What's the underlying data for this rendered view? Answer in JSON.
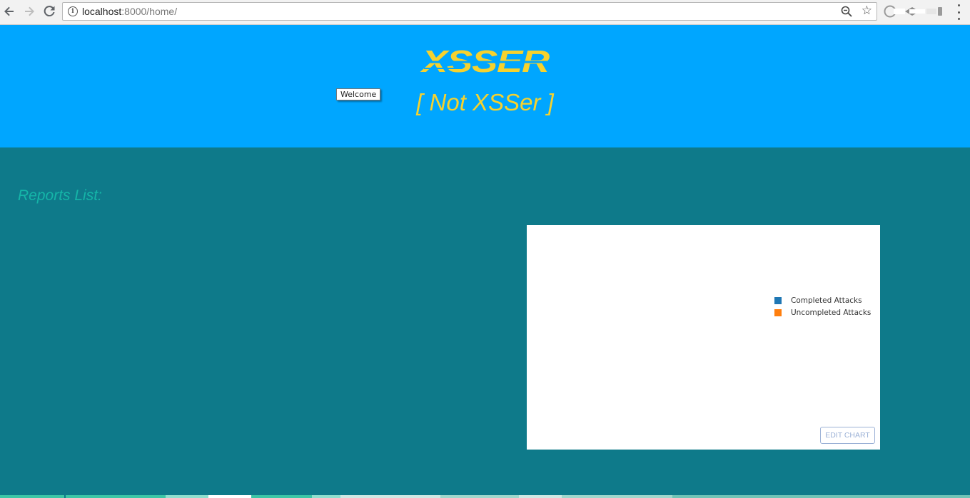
{
  "browser": {
    "url_host": "localhost",
    "url_rest": ":8000/home/",
    "nav": {
      "back_icon": "back-arrow-icon",
      "forward_icon": "forward-arrow-icon",
      "reload_icon": "reload-icon"
    }
  },
  "header": {
    "logo_text": "XSSER",
    "subtitle": "[ Not XSSer ]",
    "tooltip": "Welcome",
    "background": "#00a6ff",
    "accent": "#f6d22e"
  },
  "main": {
    "background": "#0e7a8a",
    "reports_title": "Reports List:"
  },
  "chart": {
    "legend": [
      {
        "label": "Completed Attacks",
        "color": "#1f77b4"
      },
      {
        "label": "Uncompleted Attacks",
        "color": "#ff7f0e"
      }
    ],
    "edit_label": "EDIT CHART"
  }
}
